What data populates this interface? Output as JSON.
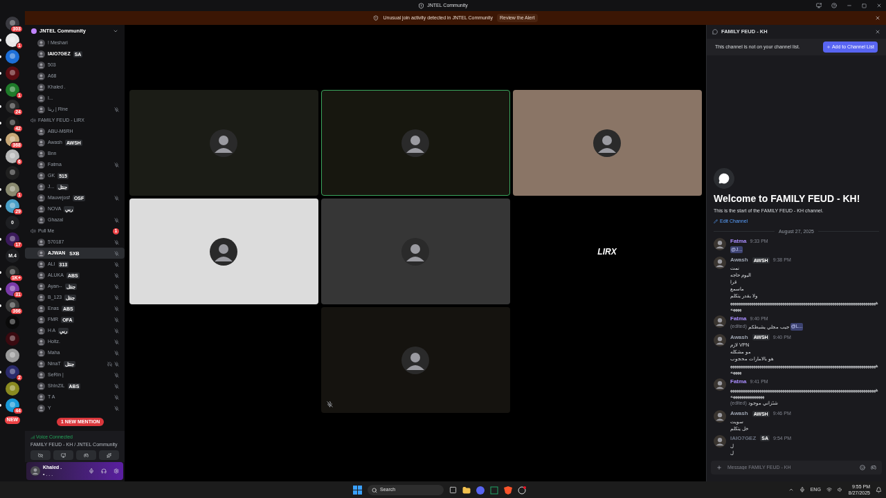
{
  "window": {
    "title": "JNTEL Community"
  },
  "alert": {
    "text": "Unusual join activity detected in JNTEL Community",
    "action": "Review the Alert"
  },
  "servers": [
    {
      "kind": "picture",
      "color": "#3a3a40",
      "badge": "303",
      "unread": false
    },
    {
      "kind": "picture",
      "color": "#e8e8e8",
      "badge": "1",
      "unread": true
    },
    {
      "kind": "picture",
      "color": "#1d6fd8",
      "unread": true
    },
    {
      "kind": "picture",
      "color": "#5a0d12",
      "unread": true
    },
    {
      "kind": "picture",
      "color": "#1f7a2a",
      "badge": "1",
      "unread": true
    },
    {
      "kind": "picture",
      "color": "#2a2a2a",
      "badge": "24",
      "unread": true
    },
    {
      "kind": "picture",
      "color": "#1b1b1b",
      "badge": "42",
      "unread": true
    },
    {
      "kind": "picture",
      "color": "#c8a878",
      "badge": "368",
      "unread": true
    },
    {
      "kind": "picture",
      "color": "#b8b8b8",
      "badge": "6",
      "unread": false
    },
    {
      "kind": "picture",
      "color": "#202020",
      "unread": false
    },
    {
      "kind": "picture",
      "color": "#8a8a70",
      "badge": "1",
      "unread": true
    },
    {
      "kind": "picture",
      "color": "#4aa0c8",
      "badge": "29",
      "unread": true
    },
    {
      "kind": "text",
      "text": "0",
      "color": "#1e1f22",
      "unread": false
    },
    {
      "kind": "picture",
      "color": "#3a1a5a",
      "badge": "17",
      "unread": true
    },
    {
      "kind": "text",
      "text": "M.4",
      "color": "#1e1f22",
      "unread": false
    },
    {
      "kind": "picture",
      "color": "#2a2a2a",
      "badge": "1K+",
      "unread": true
    },
    {
      "kind": "picture",
      "color": "#7a3aa8",
      "badge": "31",
      "unread": true
    },
    {
      "kind": "picture",
      "color": "#3a3a3a",
      "badge": "366",
      "unread": true
    },
    {
      "kind": "picture",
      "color": "#0a0a0a",
      "unread": false
    },
    {
      "kind": "picture",
      "color": "#3a0a10",
      "unread": false
    },
    {
      "kind": "picture",
      "color": "#9a9a9a",
      "unread": false
    },
    {
      "kind": "picture",
      "color": "#2a2a6a",
      "badge": "2",
      "unread": true
    },
    {
      "kind": "picture",
      "color": "#8a8a20",
      "unread": false
    },
    {
      "kind": "picture",
      "color": "#1a9ad8",
      "badge": "44",
      "unread": true
    }
  ],
  "new_pill": "NEW",
  "sidebar": {
    "server": "JNTEL Community",
    "groups": [
      {
        "users": [
          {
            "name": "! Meshari",
            "muted": false,
            "deafened": false,
            "bold": false,
            "hovered": false
          },
          {
            "name": "IAIO7GEZ",
            "tag": "SA",
            "muted": false,
            "deafened": false,
            "bold": true,
            "hovered": false
          },
          {
            "name": "503",
            "muted": false,
            "deafened": false,
            "bold": false,
            "hovered": false
          },
          {
            "name": "A68",
            "muted": false,
            "deafened": false,
            "bold": false,
            "hovered": false
          },
          {
            "name": "Khaled .",
            "muted": false,
            "deafened": false,
            "bold": false,
            "hovered": false
          },
          {
            "name": "I...",
            "muted": false,
            "deafened": false,
            "bold": false,
            "hovered": false
          },
          {
            "name": "ريتا | Rine",
            "muted": true,
            "deafened": false,
            "bold": false,
            "hovered": false
          }
        ]
      },
      {
        "name": "FAMILY FEUD - LIRX",
        "users": [
          {
            "name": "ABU-M6RH",
            "muted": false,
            "deafened": false,
            "bold": false,
            "hovered": false
          },
          {
            "name": "Awash",
            "tag": "AWSH",
            "muted": false,
            "deafened": false,
            "bold": false,
            "hovered": false
          },
          {
            "name": "Bnn",
            "muted": false,
            "deafened": false,
            "bold": false,
            "hovered": false
          },
          {
            "name": "Fatma",
            "muted": true,
            "deafened": false,
            "bold": false,
            "hovered": false
          },
          {
            "name": "GK",
            "tag": "515",
            "muted": false,
            "deafened": false,
            "bold": false,
            "hovered": false
          },
          {
            "name": "J...",
            "tag": "جنتل",
            "muted": false,
            "deafened": false,
            "bold": false,
            "hovered": false
          },
          {
            "name": "Mauvejosf",
            "tag": "OSF",
            "muted": true,
            "deafened": false,
            "bold": false,
            "hovered": false
          },
          {
            "name": "NOVA",
            "tag": "ربي",
            "muted": false,
            "deafened": false,
            "bold": false,
            "hovered": false
          },
          {
            "name": "Ghazal",
            "muted": true,
            "deafened": false,
            "bold": false,
            "hovered": false
          }
        ]
      },
      {
        "name": "Pull Me",
        "badge": "1",
        "users": [
          {
            "name": "570187",
            "muted": true,
            "deafened": false,
            "bold": false,
            "hovered": false
          },
          {
            "name": "AJWAN",
            "tag": "SXB",
            "muted": true,
            "deafened": false,
            "bold": true,
            "hovered": true
          },
          {
            "name": "ALI",
            "tag": "313",
            "muted": true,
            "deafened": false,
            "bold": false,
            "hovered": false
          },
          {
            "name": "ALUKA",
            "tag": "ABS",
            "muted": true,
            "deafened": false,
            "bold": false,
            "hovered": false
          },
          {
            "name": "Ayan--",
            "tag": "جنتل",
            "muted": true,
            "deafened": false,
            "bold": false,
            "hovered": false
          },
          {
            "name": "B_123",
            "tag": "جنتل",
            "muted": true,
            "deafened": false,
            "bold": false,
            "hovered": false
          },
          {
            "name": "Enas",
            "tag": "ABS",
            "muted": true,
            "deafened": false,
            "bold": false,
            "hovered": false
          },
          {
            "name": "FMR",
            "tag": "OFA",
            "muted": true,
            "deafened": false,
            "bold": false,
            "hovered": false
          },
          {
            "name": "H A",
            "tag": "ربي",
            "muted": true,
            "deafened": false,
            "bold": false,
            "hovered": false
          },
          {
            "name": "Holtz.",
            "muted": true,
            "deafened": false,
            "bold": false,
            "hovered": false
          },
          {
            "name": "Maha",
            "muted": true,
            "deafened": false,
            "bold": false,
            "hovered": false
          },
          {
            "name": "NinaT",
            "tag": "جنتل",
            "muted": true,
            "deafened": true,
            "bold": false,
            "hovered": false
          },
          {
            "name": "SeRin |",
            "muted": true,
            "deafened": false,
            "bold": false,
            "hovered": false
          },
          {
            "name": "ShInZIL",
            "tag": "ABS",
            "muted": true,
            "deafened": false,
            "bold": false,
            "hovered": false
          },
          {
            "name": "T A",
            "muted": true,
            "deafened": false,
            "bold": false,
            "hovered": false
          },
          {
            "name": "Y",
            "muted": true,
            "deafened": false,
            "bold": false,
            "hovered": false
          }
        ]
      }
    ],
    "mention_pill": "1 NEW MENTION"
  },
  "voice": {
    "status": "Voice Connected",
    "channel": "FAMILY FEUD - KH / JNTEL Community"
  },
  "user": {
    "name": "Khaled .",
    "status": "• . . ."
  },
  "video": {
    "rows": [
      [
        {
          "kind": "avatar",
          "color": "#1b1c16",
          "speaking": false,
          "muted": false
        },
        {
          "kind": "avatar",
          "color": "#17170f",
          "speaking": true,
          "muted": false
        },
        {
          "kind": "avatar",
          "color": "#8a7566",
          "speaking": false,
          "muted": false
        }
      ],
      [
        {
          "kind": "avatar",
          "color": "#dcdcdc",
          "speaking": false,
          "muted": false
        },
        {
          "kind": "avatar",
          "color": "#363636",
          "speaking": false,
          "muted": false
        },
        {
          "kind": "logo",
          "color": "#000000",
          "speaking": false,
          "muted": false,
          "text": "LIRX"
        }
      ],
      [
        {
          "kind": "avatar",
          "color": "#15130f",
          "speaking": false,
          "muted": true
        }
      ]
    ]
  },
  "chat": {
    "channel": "FAMILY FEUD - KH",
    "notice": "This channel is not on your channel list.",
    "add_button": "Add to Channel List",
    "welcome": "Welcome to FAMILY FEUD - KH!",
    "intro": "This is the start of the FAMILY FEUD - KH channel.",
    "edit": "Edit Channel",
    "date": "August 27, 2025",
    "messages": [
      {
        "author": "Fatma",
        "color": "#a78bfa",
        "time": "9:33 PM",
        "lines": [
          {
            "mention": "@J..."
          }
        ]
      },
      {
        "author": "Awash",
        "color": "#9ca3af",
        "tag": "AWSH",
        "time": "9:38 PM",
        "lines": [
          {
            "text": "نمت"
          },
          {
            "text": "اليوم حاجه"
          },
          {
            "text": "قرا"
          },
          {
            "text": "ماسمع"
          },
          {
            "text": "ولا يقدر يتكلم"
          },
          {
            "text": "هههههههههههههههههههههههههههههههههههههههههههههههههههههههههههههههههههههههههههه"
          }
        ]
      },
      {
        "author": "Fatma",
        "color": "#a78bfa",
        "time": "9:40 PM",
        "lines": [
          {
            "edited_note": "(edited)",
            "text": "جيب مجلي يشبطكم",
            "mention": "@L..."
          }
        ]
      },
      {
        "author": "Awash",
        "color": "#9ca3af",
        "tag": "AWSH",
        "time": "9:40 PM",
        "lines": [
          {
            "text": "لازم VPN"
          },
          {
            "text": "مو مشكله"
          },
          {
            "text": "هو بالامارات محجوب"
          },
          {
            "text": "هههههههههههههههههههههههههههههههههههههههههههههههههههههههههههههههههههههههههههه"
          }
        ]
      },
      {
        "author": "Fatma",
        "color": "#a78bfa",
        "time": "9:41 PM",
        "lines": [
          {
            "text": "ههههههههههههههههههههههههههههههههههههههههههههههههههههههههههههههههههههههههههههههههههههههه"
          },
          {
            "edited_note": "(edited)",
            "text": "شئزاني موجود"
          }
        ]
      },
      {
        "author": "Awash",
        "color": "#9ca3af",
        "tag": "AWSH",
        "time": "9:46 PM",
        "lines": [
          {
            "text": "سويت"
          },
          {
            "text": "خل يتكلم"
          }
        ]
      },
      {
        "author": "IAIO7GEZ",
        "color": "#6b7280",
        "tag": "SA",
        "time": "9:54 PM",
        "lines": [
          {
            "text": "ل"
          },
          {
            "text": "ل"
          }
        ]
      }
    ],
    "input": {
      "placeholder": "Message FAMILY FEUD - KH"
    }
  },
  "taskbar": {
    "search": "Search",
    "language": "ENG",
    "time": "9:55 PM",
    "date": "8/27/2025"
  }
}
